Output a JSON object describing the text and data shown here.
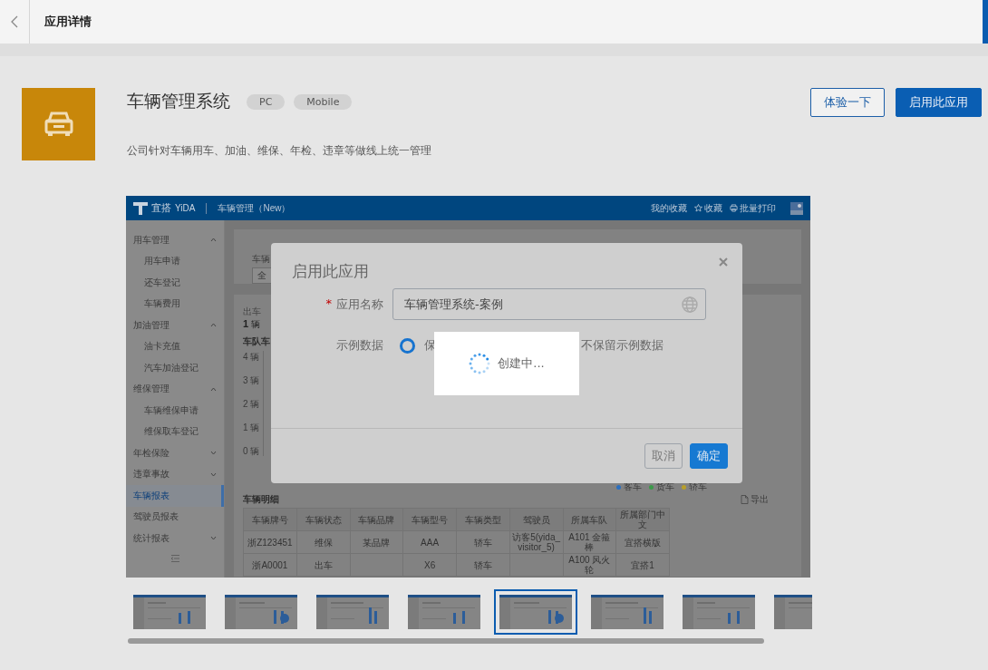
{
  "header": {
    "title": "应用详情"
  },
  "app": {
    "name": "车辆管理系统",
    "tags": [
      "PC",
      "Mobile"
    ],
    "description": "公司针对车辆用车、加油、维保、年检、违章等做线上统一管理",
    "actions": [
      {
        "label": "体验一下",
        "kind": "secondary"
      },
      {
        "label": "启用此应用",
        "kind": "primary"
      }
    ]
  },
  "preview": {
    "brand": "宜搭",
    "brand_en": "YiDA",
    "app_title": "车辆管理（New）",
    "header_links": [
      {
        "label": "我的收藏",
        "kind": "plain"
      },
      {
        "label": "收藏",
        "kind": "star"
      },
      {
        "label": "批量打印",
        "kind": "print"
      }
    ],
    "sidebar": [
      {
        "label": "用车管理",
        "selected": false,
        "expanded": true,
        "children": [
          {
            "label": "用车申请",
            "selected": false
          },
          {
            "label": "还车登记",
            "selected": false
          },
          {
            "label": "车辆费用",
            "selected": false
          }
        ]
      },
      {
        "label": "加油管理",
        "selected": false,
        "expanded": true,
        "children": [
          {
            "label": "油卡充值",
            "selected": false
          },
          {
            "label": "汽车加油登记",
            "selected": false
          }
        ]
      },
      {
        "label": "维保管理",
        "selected": false,
        "expanded": true,
        "children": [
          {
            "label": "车辆维保申请",
            "selected": false
          },
          {
            "label": "维保取车登记",
            "selected": false
          }
        ]
      },
      {
        "label": "年检保险",
        "selected": false,
        "expanded": false
      },
      {
        "label": "违章事故",
        "selected": false,
        "expanded": false
      },
      {
        "label": "车辆报表",
        "selected": true
      },
      {
        "label": "驾驶员报表",
        "selected": false
      },
      {
        "label": "统计报表",
        "selected": false,
        "expanded": false
      }
    ],
    "filter": {
      "label": "车辆",
      "value": "全"
    },
    "stat": {
      "label": "出车",
      "value": "1",
      "unit": "辆"
    },
    "chart": {
      "title": "车队车",
      "y_labels": [
        "4 辆",
        "3 辆",
        "2 辆",
        "1 辆",
        "0 辆"
      ]
    },
    "legend": [
      {
        "label": "客车",
        "color": "#2a6fc0"
      },
      {
        "label": "货车",
        "color": "#3c9a4a"
      },
      {
        "label": "轿车",
        "color": "#b9a02a"
      }
    ],
    "table": {
      "title": "车辆明细",
      "export": "导出",
      "columns": [
        "车辆牌号",
        "车辆状态",
        "车辆品牌",
        "车辆型号",
        "车辆类型",
        "驾驶员",
        "所属车队",
        "所属部门中文"
      ],
      "rows": [
        [
          "浙Z123451",
          "维保",
          "某品牌",
          "AAA",
          "轿车",
          "访客5(yida_visitor_5)",
          "A101 金箍棒",
          "宜搭横版"
        ],
        [
          "浙A0001",
          "出车",
          "",
          "X6",
          "轿车",
          "",
          "A100 风火轮",
          "宜搭1"
        ]
      ]
    }
  },
  "thumbnails": [
    {
      "selected": false
    },
    {
      "selected": false
    },
    {
      "selected": false
    },
    {
      "selected": false
    },
    {
      "selected": true
    },
    {
      "selected": false
    },
    {
      "selected": false
    },
    {
      "selected": false
    }
  ],
  "dialog": {
    "title": "启用此应用",
    "required_mark": "*",
    "name_label": "应用名称",
    "name_value": "车辆管理系统-案例",
    "data_label": "示例数据",
    "options": [
      {
        "label": "保",
        "selected": true
      },
      {
        "label": "不保留示例数据"
      }
    ],
    "buttons": [
      {
        "label": "取消",
        "kind": "secondary"
      },
      {
        "label": "确定",
        "kind": "primary"
      }
    ]
  },
  "loading": {
    "text": "创建中..."
  }
}
